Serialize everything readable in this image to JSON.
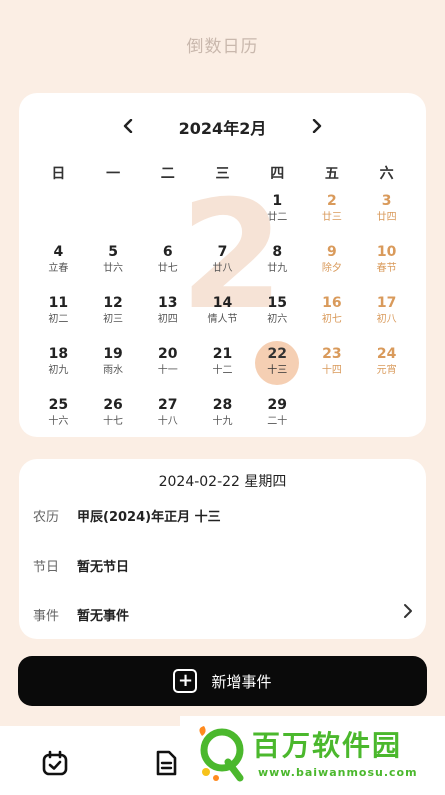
{
  "app_title": "倒数日历",
  "calendar": {
    "month_label": "2024年2月",
    "big_number": "2",
    "prev_icon": "chevron-left-icon",
    "next_icon": "chevron-right-icon",
    "weekdays": [
      "日",
      "一",
      "二",
      "三",
      "四",
      "五",
      "六"
    ],
    "leading_blanks": 4,
    "selected_day": "22",
    "weekend_color": "#d99a5b",
    "selected_color": "#f5cfb3",
    "days": [
      {
        "d": "1",
        "l": "廿二"
      },
      {
        "d": "2",
        "l": "廿三"
      },
      {
        "d": "3",
        "l": "廿四"
      },
      {
        "d": "4",
        "l": "立春"
      },
      {
        "d": "5",
        "l": "廿六"
      },
      {
        "d": "6",
        "l": "廿七"
      },
      {
        "d": "7",
        "l": "廿八"
      },
      {
        "d": "8",
        "l": "廿九"
      },
      {
        "d": "9",
        "l": "除夕"
      },
      {
        "d": "10",
        "l": "春节"
      },
      {
        "d": "11",
        "l": "初二"
      },
      {
        "d": "12",
        "l": "初三"
      },
      {
        "d": "13",
        "l": "初四"
      },
      {
        "d": "14",
        "l": "情人节"
      },
      {
        "d": "15",
        "l": "初六"
      },
      {
        "d": "16",
        "l": "初七"
      },
      {
        "d": "17",
        "l": "初八"
      },
      {
        "d": "18",
        "l": "初九"
      },
      {
        "d": "19",
        "l": "雨水"
      },
      {
        "d": "20",
        "l": "十一"
      },
      {
        "d": "21",
        "l": "十二"
      },
      {
        "d": "22",
        "l": "十三"
      },
      {
        "d": "23",
        "l": "十四"
      },
      {
        "d": "24",
        "l": "元宵"
      },
      {
        "d": "25",
        "l": "十六"
      },
      {
        "d": "26",
        "l": "十七"
      },
      {
        "d": "27",
        "l": "十八"
      },
      {
        "d": "28",
        "l": "十九"
      },
      {
        "d": "29",
        "l": "二十"
      }
    ]
  },
  "info": {
    "date_line": "2024-02-22 星期四",
    "lunar_label": "农历",
    "lunar_value": "甲辰(2024)年正月 十三",
    "holiday_label": "节日",
    "holiday_value": "暂无节日",
    "event_label": "事件",
    "event_value": "暂无事件",
    "event_icon": "chevron-right-icon"
  },
  "add_button": {
    "label": "新增事件",
    "icon": "plus-square-icon"
  },
  "tabbar": {
    "tabs": [
      {
        "icon": "calendar-check-icon"
      },
      {
        "icon": "document-icon"
      }
    ]
  },
  "watermark": {
    "name": "百万软件园",
    "url": "www.baiwanmosu.com",
    "color": "#4bb82d"
  }
}
